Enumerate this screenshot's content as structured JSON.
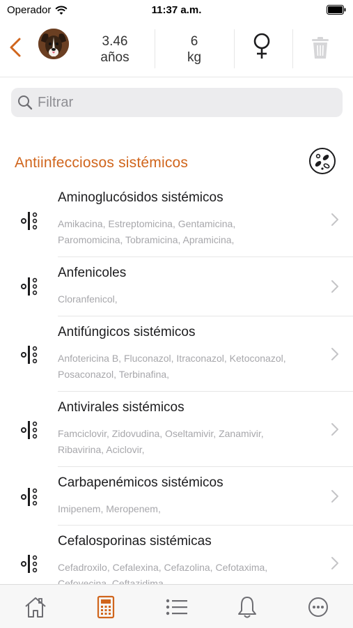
{
  "status_bar": {
    "carrier": "Operador",
    "time": "11:37 a.m."
  },
  "patient": {
    "age_value": "3.46",
    "age_unit": "años",
    "weight_value": "6",
    "weight_unit": "kg",
    "sex_symbol": "♀"
  },
  "search": {
    "placeholder": "Filtrar",
    "value": ""
  },
  "section": {
    "title": "Antiinfecciosos sistémicos"
  },
  "items": [
    {
      "title": "Aminoglucósidos sistémicos",
      "line1": "Amikacina, Estreptomicina, Gentamicina,",
      "line2": "Paromomicina, Tobramicina, Apramicina,"
    },
    {
      "title": "Anfenicoles",
      "line1": "Cloranfenicol,",
      "line2": ""
    },
    {
      "title": "Antifúngicos sistémicos",
      "line1": "Anfotericina B, Fluconazol, Itraconazol, Ketoconazol,",
      "line2": "Posaconazol, Terbinafina,"
    },
    {
      "title": "Antivirales sistémicos",
      "line1": "Famciclovir, Zidovudina, Oseltamivir, Zanamivir,",
      "line2": "Ribavirina, Aciclovir,"
    },
    {
      "title": "Carbapenémicos sistémicos",
      "line1": "Imipenem, Meropenem,",
      "line2": ""
    },
    {
      "title": "Cefalosporinas sistémicas",
      "line1": "Cefadroxilo, Cefalexina, Cefazolina, Cefotaxima,",
      "line2": "Cefovecina, Ceftazidima,"
    }
  ],
  "colors": {
    "accent": "#d0651c",
    "text": "#1c1c1e",
    "muted": "#a7a7ab"
  }
}
